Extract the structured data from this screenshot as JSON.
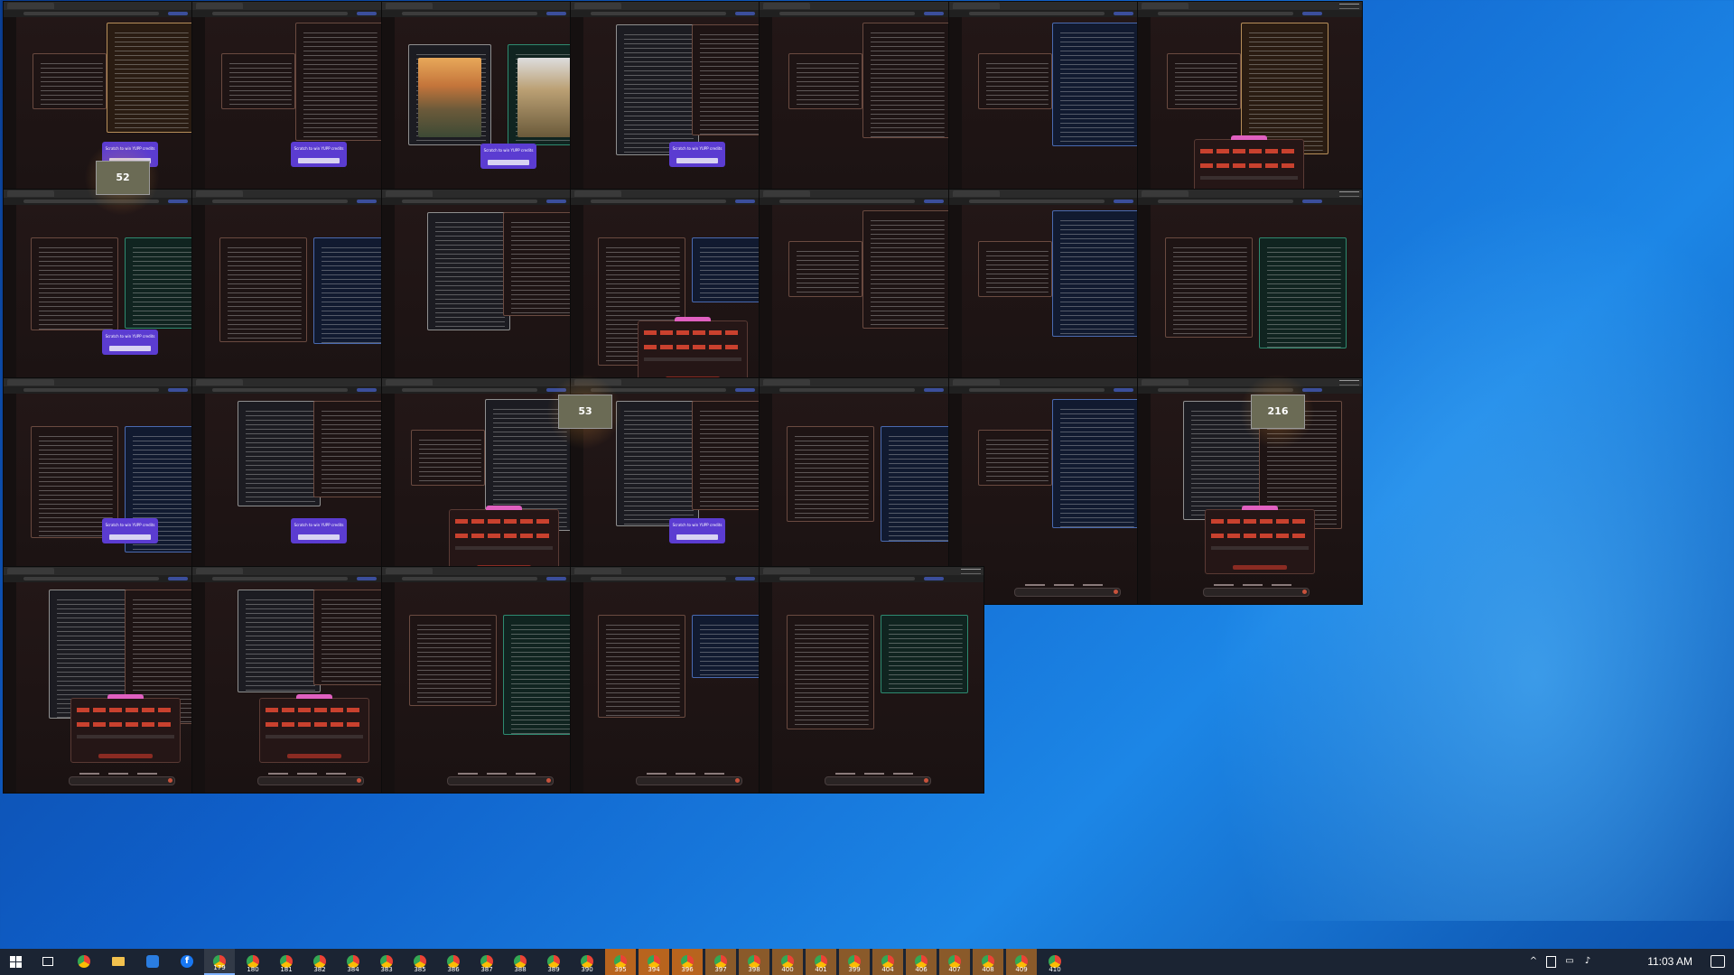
{
  "window_titles": [
    "Chat window",
    "Chat window",
    "Chat window",
    "Chat window",
    "Chat window",
    "Chat window",
    "Chat window",
    "Chat window",
    "Chat window",
    "Chat window",
    "Chat window",
    "Chat window",
    "Chat window",
    "Chat window",
    "Chat window",
    "Chat window",
    "Chat window",
    "Chat window",
    "Chat window",
    "Chat window",
    "Chat window",
    "Chat window",
    "Chat window",
    "Chat window",
    "Chat window",
    "Chat window"
  ],
  "overlays": {
    "counter_1": "52",
    "counter_2": "53",
    "counter_3": "216",
    "scratch_label": "Scratch to win YUPP credits"
  },
  "taskbar": {
    "apps": [
      {
        "name": "chrome",
        "num": "179"
      },
      {
        "name": "chrome",
        "num": "180"
      },
      {
        "name": "chrome",
        "num": "181"
      },
      {
        "name": "chrome",
        "num": "382"
      },
      {
        "name": "chrome",
        "num": "384"
      },
      {
        "name": "chrome",
        "num": "383"
      },
      {
        "name": "chrome",
        "num": "385"
      },
      {
        "name": "chrome",
        "num": "386"
      },
      {
        "name": "chrome",
        "num": "387"
      },
      {
        "name": "chrome",
        "num": "388"
      },
      {
        "name": "chrome",
        "num": "389"
      },
      {
        "name": "chrome",
        "num": "390"
      },
      {
        "name": "chrome",
        "num": "395"
      },
      {
        "name": "chrome",
        "num": "394"
      },
      {
        "name": "chrome",
        "num": "396"
      },
      {
        "name": "chrome",
        "num": "397"
      },
      {
        "name": "chrome",
        "num": "398"
      },
      {
        "name": "chrome",
        "num": "400"
      },
      {
        "name": "chrome",
        "num": "401"
      },
      {
        "name": "chrome",
        "num": "399"
      },
      {
        "name": "chrome",
        "num": "404"
      },
      {
        "name": "chrome",
        "num": "406"
      },
      {
        "name": "chrome",
        "num": "407"
      },
      {
        "name": "chrome",
        "num": "408"
      },
      {
        "name": "chrome",
        "num": "409"
      },
      {
        "name": "chrome",
        "num": "410"
      }
    ],
    "clock": "11:03 AM"
  },
  "colors": {
    "accent": "#5b3cd1",
    "taskbar": "#1b2433",
    "highlight": "#b8641e"
  }
}
